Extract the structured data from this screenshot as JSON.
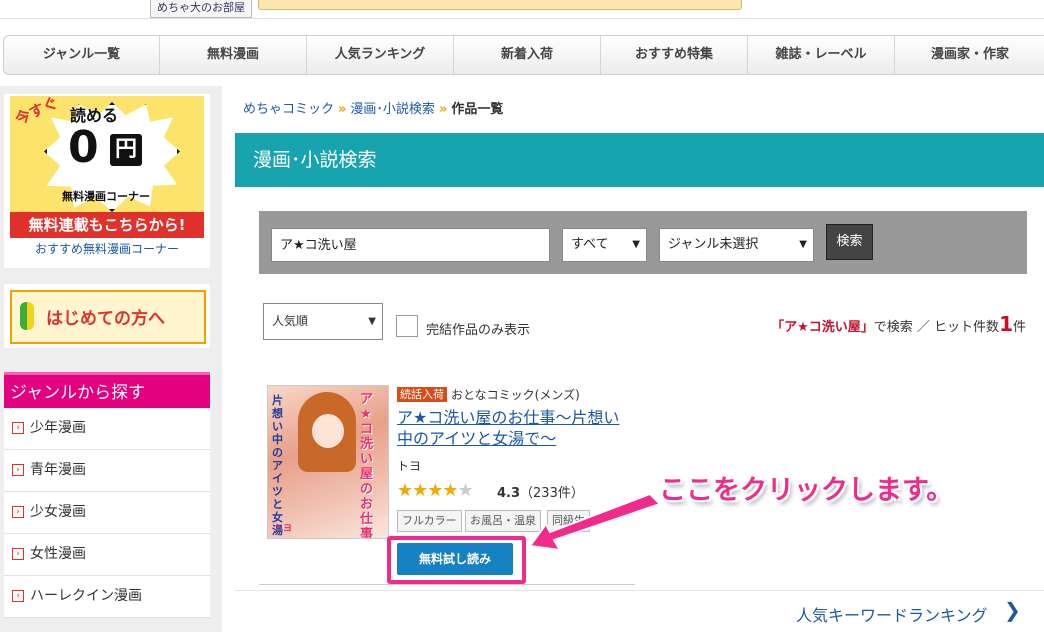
{
  "top": {
    "site_tag": "めちゃ大のお部屋"
  },
  "nav": {
    "items": [
      "ジャンル一覧",
      "無料漫画",
      "人気ランキング",
      "新着入荷",
      "おすすめ特集",
      "雑誌・レーベル",
      "漫画家・作家"
    ]
  },
  "sidebar": {
    "promo_free": {
      "imasugu": "今すぐ",
      "yomeru": "読める",
      "zero": "0",
      "en": "円",
      "corner": "無料漫画コーナー",
      "band": "無料連載もこちらから!",
      "link": "おすすめ無料漫画コーナー"
    },
    "promo_first": "はじめての方へ",
    "genre_header": "ジャンルから探す",
    "genres": [
      "少年漫画",
      "青年漫画",
      "少女漫画",
      "女性漫画",
      "ハーレクイン漫画"
    ]
  },
  "breadcrumb": {
    "home": "めちゃコミック",
    "search": "漫画･小説検索",
    "current": "作品一覧",
    "sep": "»"
  },
  "section_title": "漫画･小説検索",
  "search": {
    "keyword": "ア★コ洗い屋",
    "type_select": "すべて",
    "genre_select": "ジャンル未選択",
    "button": "検索"
  },
  "filters": {
    "sort": "人気順",
    "completed_only": "完結作品のみ表示"
  },
  "result": {
    "query_quoted": "「ア★コ洗い屋」",
    "suffix1": "で検索 ／ ヒット件数",
    "count": "1",
    "suffix2": "件"
  },
  "item": {
    "badge": "続話入荷",
    "category": "おとなコミック(メンズ)",
    "title": "ア★コ洗い屋のお仕事～片想い中のアイツと女湯で～",
    "author": "トヨ",
    "stars": "★★★★",
    "half_star": "★",
    "rating": "4.3",
    "reviews": "（233件）",
    "tags": [
      "フルカラー",
      "お風呂・温泉",
      "同級生"
    ],
    "trial_button": "無料試し読み",
    "cover_title": "ア★コ洗い屋のお仕事",
    "cover_subtitle": "片想い中のアイツと女湯で",
    "cover_author": "トヨ"
  },
  "annotation": "ここをクリックします。",
  "keyword_ranking": "人気キーワードランキング",
  "colors": {
    "teal": "#17a4ae",
    "pink_header": "#e3007f",
    "link_blue": "#1a58a8",
    "highlight_pink": "#f22b8a",
    "button_blue": "#1682c4"
  }
}
